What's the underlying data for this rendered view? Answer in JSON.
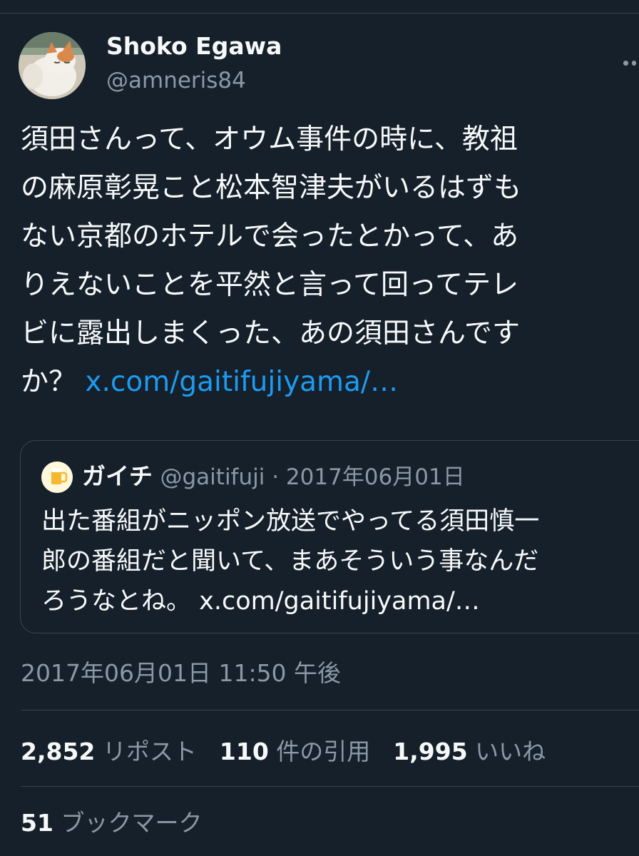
{
  "author": {
    "name": "Shoko Egawa",
    "handle": "@amneris84",
    "avatar_icon": "cat-photo-avatar"
  },
  "more_icon": "more-horizontal-icon",
  "tweet": {
    "lines": [
      "須田さんって、オウム事件の時に、教祖",
      "の麻原彰晃こと松本智津夫がいるはずも",
      "ない京都のホテルで会ったとかって、あ",
      "りえないことを平然と言って回ってテレ",
      "ビに露出しまくった、あの須田さんです"
    ],
    "last_line_prefix": "か？",
    "link": "x.com/gaitifujiyama/…"
  },
  "quote": {
    "avatar_icon": "beer-mug-avatar",
    "name": "ガイチ",
    "meta": "@gaitifuji · 2017年06月01日",
    "lines": [
      "出た番組がニッポン放送でやってる須田慎一",
      "郎の番組だと聞いて、まあそういう事なんだ",
      "ろうなとね。 x.com/gaitifujiyama/…"
    ]
  },
  "timestamp": "2017年06月01日 11:50 午後",
  "stats": {
    "reposts_count": "2,852",
    "reposts_label": "リポスト",
    "quotes_count": "110",
    "quotes_label": "件の引用",
    "likes_count": "1,995",
    "likes_label": "いいね",
    "bookmarks_count": "51",
    "bookmarks_label": "ブックマーク"
  },
  "colors": {
    "background": "#15202b",
    "text": "#f7f9f9",
    "secondary_text": "#8b98a5",
    "link": "#1d9bf0",
    "border": "#38444d"
  }
}
